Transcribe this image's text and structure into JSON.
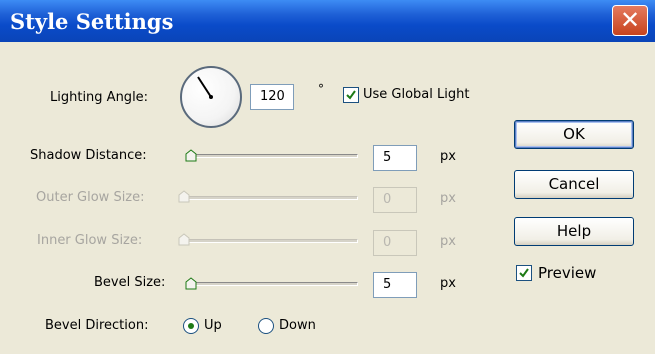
{
  "dialog": {
    "title": "Style Settings",
    "close_glyph": "✕"
  },
  "lighting": {
    "label": "Lighting Angle:",
    "value": "120",
    "unit": "°",
    "global_light_label": "Use Global Light",
    "global_light_checked": true
  },
  "shadow_distance": {
    "label": "Shadow Distance:",
    "value": "5",
    "unit": "px",
    "enabled": true
  },
  "outer_glow": {
    "label": "Outer Glow Size:",
    "value": "0",
    "unit": "px",
    "enabled": false
  },
  "inner_glow": {
    "label": "Inner Glow Size:",
    "value": "0",
    "unit": "px",
    "enabled": false
  },
  "bevel_size": {
    "label": "Bevel Size:",
    "value": "5",
    "unit": "px",
    "enabled": true
  },
  "bevel_direction": {
    "label": "Bevel Direction:",
    "options": [
      {
        "label": "Up",
        "selected": true
      },
      {
        "label": "Down",
        "selected": false
      }
    ]
  },
  "buttons": {
    "ok": "OK",
    "cancel": "Cancel",
    "help": "Help"
  },
  "preview": {
    "label": "Preview",
    "checked": true
  },
  "icons": [
    "close-icon",
    "angle-dial-icon",
    "checkmark-icon",
    "slider-thumb-icon",
    "radio-dot-icon"
  ],
  "colors": {
    "title_bar": "#0a4bc9",
    "close": "#c8431e",
    "dialog_bg": "#ece9d8",
    "check": "#1d7a15"
  }
}
